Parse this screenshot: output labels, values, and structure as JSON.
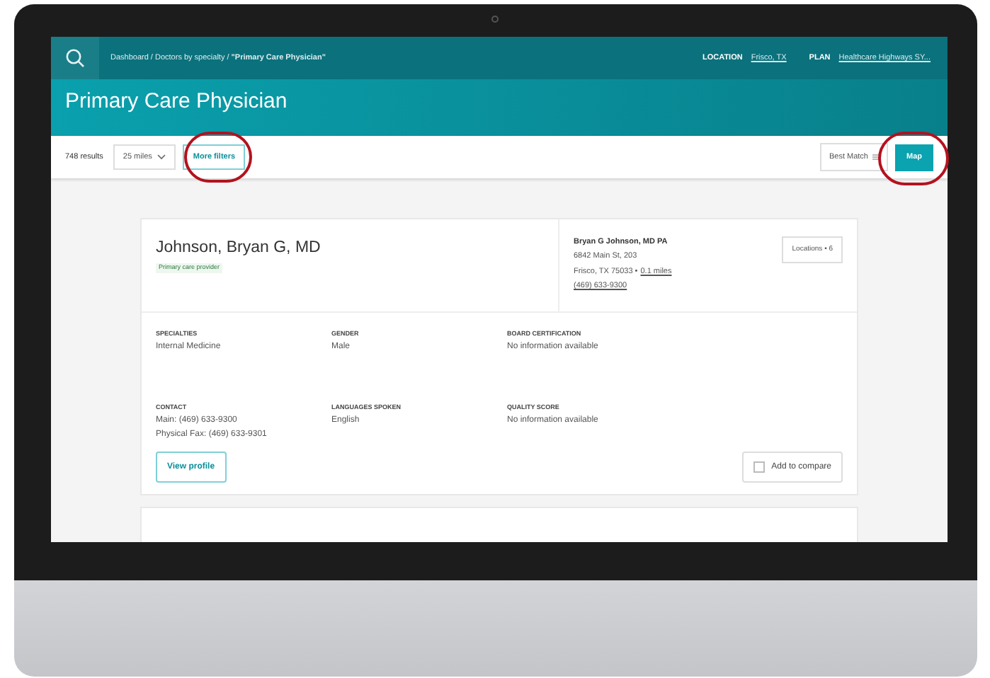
{
  "top_bar": {
    "breadcrumb": "Dashboard / Doctors by specialty / **\"Primary Care Physician\"**",
    "location": {
      "label": "LOCATION",
      "value": "Frisco, TX"
    },
    "plan": {
      "label": "PLAN",
      "value": "Healthcare Highways SY..."
    }
  },
  "page_title": "Primary Care Physician",
  "filter_bar": {
    "results": "748 results",
    "distance": "25 miles",
    "more_filters": "More filters",
    "sort": "Best Match",
    "map": "Map"
  },
  "providers": [
    {
      "name": "Johnson, Bryan G, MD",
      "badge": "Primary care provider",
      "practice": "Bryan G Johnson, MD PA",
      "address": "6842 Main St, 203",
      "city": "Frisco, TX 75033 •",
      "distance": "0.1 miles",
      "phone": "(469) 633-9300",
      "locations": "Locations • 6",
      "details": [
        {
          "label": "SPECIALTIES",
          "lines": [
            "Internal Medicine"
          ]
        },
        {
          "label": "GENDER",
          "lines": [
            "Male"
          ]
        },
        {
          "label": "BOARD CERTIFICATION",
          "lines": [
            "No information available"
          ]
        },
        {
          "label": "CONTACT",
          "lines": [
            "Main: (469) 633-9300",
            "Physical Fax: (469) 633-9301"
          ]
        },
        {
          "label": "LANGUAGES SPOKEN",
          "lines": [
            "English"
          ]
        },
        {
          "label": "QUALITY SCORE",
          "lines": [
            "No information available"
          ]
        }
      ],
      "view_profile": "View profile",
      "compare": {
        "label": "Add to compare",
        "checked": false
      }
    }
  ]
}
